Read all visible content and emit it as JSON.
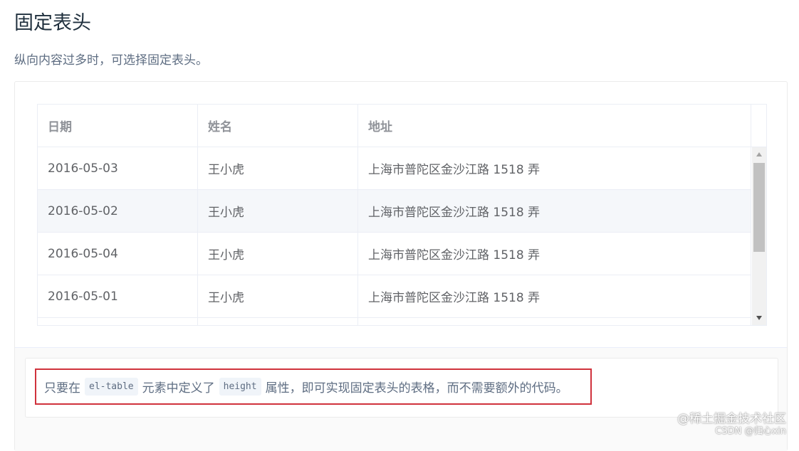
{
  "section": {
    "title": "固定表头",
    "description": "纵向内容过多时，可选择固定表头。"
  },
  "table": {
    "columns": [
      "日期",
      "姓名",
      "地址"
    ],
    "rows": [
      [
        "2016-05-03",
        "王小虎",
        "上海市普陀区金沙江路 1518 弄"
      ],
      [
        "2016-05-02",
        "王小虎",
        "上海市普陀区金沙江路 1518 弄"
      ],
      [
        "2016-05-04",
        "王小虎",
        "上海市普陀区金沙江路 1518 弄"
      ],
      [
        "2016-05-01",
        "王小虎",
        "上海市普陀区金沙江路 1518 弄"
      ]
    ],
    "scrollbar": {
      "up_icon": "triangle-up-icon",
      "down_icon": "triangle-down-icon"
    }
  },
  "note": {
    "text_1": "只要在",
    "code_1": "el-table",
    "text_2": "元素中定义了",
    "code_2": "height",
    "text_3": "属性，即可实现固定表头的表格，而不需要额外的代码。",
    "highlight_color": "#d0323c"
  },
  "watermark": {
    "line1": "@稀土掘金技术社区",
    "line2": "CSDN @归心xin"
  }
}
